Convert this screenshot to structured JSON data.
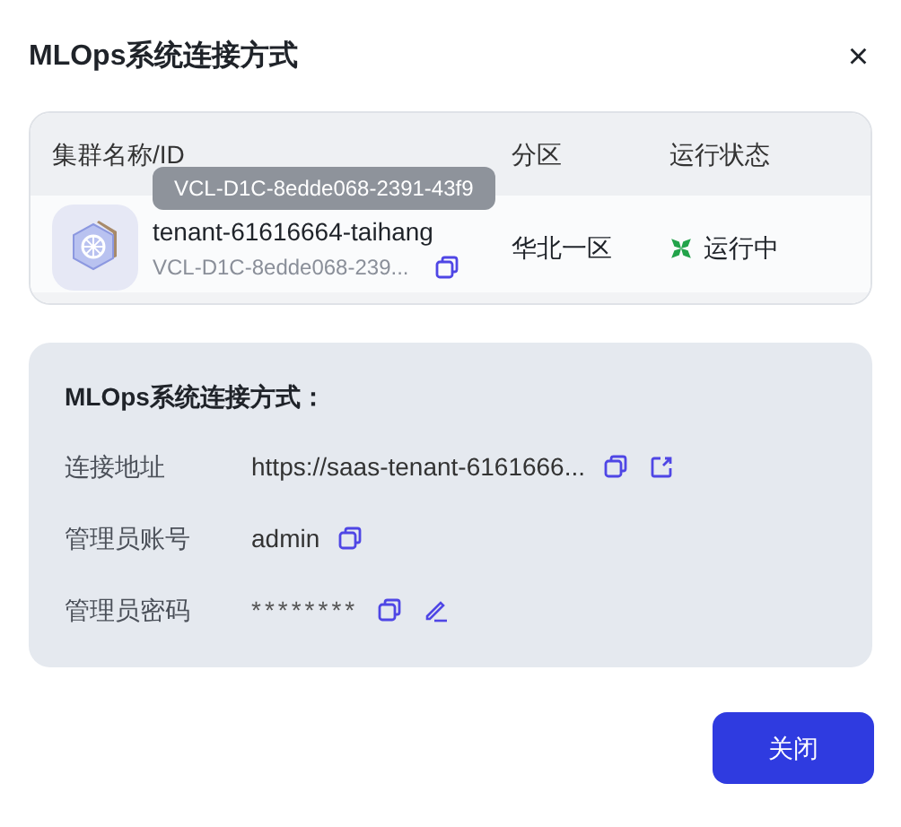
{
  "dialog": {
    "title": "MLOps系统连接方式",
    "close": "×"
  },
  "table": {
    "columns": [
      "集群名称/ID",
      "分区",
      "运行状态"
    ],
    "rows": [
      {
        "name": "tenant-61616664-taihang",
        "id": "VCL-D1C-8edde068-239...",
        "region": "华北一区",
        "status": {
          "label": "运行中",
          "kind": "running"
        }
      }
    ],
    "tooltip": "VCL-D1C-8edde068-2391-43f9"
  },
  "connection": {
    "heading": "MLOps系统连接方式：",
    "fields": [
      {
        "label": "连接地址",
        "value": "https://saas-tenant-6161666...",
        "kind": "link"
      },
      {
        "label": "管理员账号",
        "value": "admin",
        "kind": "plain"
      },
      {
        "label": "管理员密码",
        "value": "********",
        "kind": "secret"
      }
    ]
  },
  "buttons": [
    "关闭"
  ]
}
